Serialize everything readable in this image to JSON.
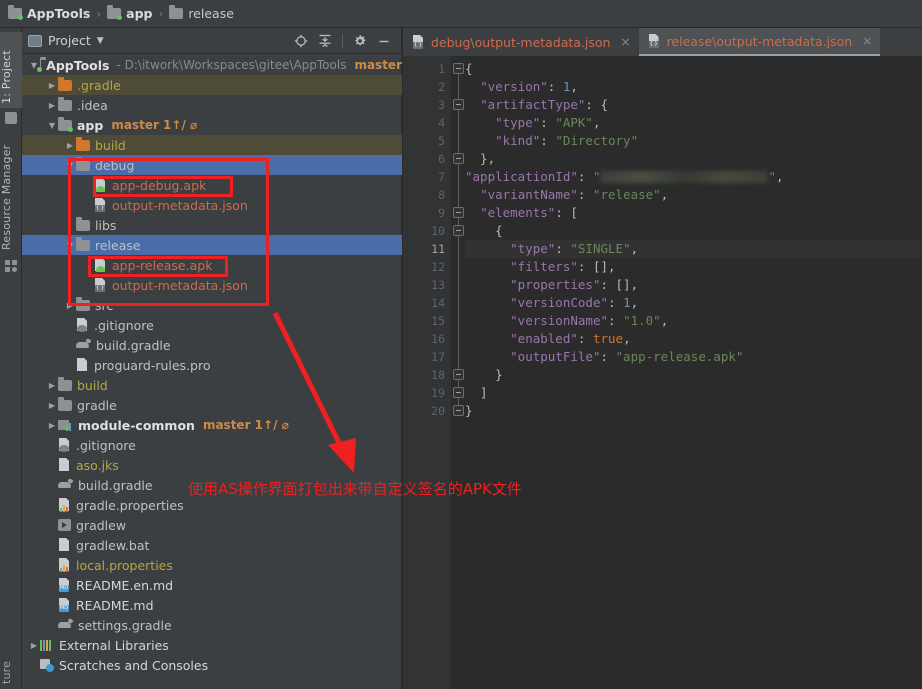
{
  "breadcrumb": {
    "items": [
      {
        "label": "AppTools",
        "icon": "module-icon",
        "bold": true
      },
      {
        "label": "app",
        "icon": "module-icon",
        "bold": true
      },
      {
        "label": "release",
        "icon": "folder-icon",
        "bold": false
      }
    ],
    "separator": "›"
  },
  "toolstrip": {
    "project_tab": "1: Project",
    "resource_tab": "Resource Manager",
    "structure_tab": "ture"
  },
  "panel": {
    "title": "Project",
    "caret": "▼",
    "tools": [
      "locate-icon",
      "collapse-all-icon",
      "gear-icon",
      "minimize-icon"
    ]
  },
  "tree": [
    {
      "id": "apptools-root",
      "indent": 0,
      "arrow": "▼",
      "icon": "module",
      "label": "AppTools",
      "style": "bold",
      "path": "- D:\\itwork\\Workspaces\\gitee\\AppTools",
      "branch": "master"
    },
    {
      "id": "gradle-dir",
      "indent": 1,
      "arrow": "▶",
      "icon": "folder-orange",
      "label": ".gradle",
      "style": "yellow",
      "row": "hl"
    },
    {
      "id": "idea-dir",
      "indent": 1,
      "arrow": "▶",
      "icon": "folder",
      "label": ".idea",
      "style": "gray"
    },
    {
      "id": "app-module",
      "indent": 1,
      "arrow": "▼",
      "icon": "module",
      "label": "app",
      "style": "bold",
      "branch": "master 1↑/ ⌀"
    },
    {
      "id": "build-dir",
      "indent": 2,
      "arrow": "▶",
      "icon": "folder-orange",
      "label": "build",
      "style": "yellow",
      "row": "hl"
    },
    {
      "id": "debug-dir",
      "indent": 2,
      "arrow": "▼",
      "icon": "folder",
      "label": "debug",
      "style": "gray",
      "row": "sel"
    },
    {
      "id": "app-debug-apk",
      "indent": 3,
      "arrow": "",
      "icon": "apk",
      "label": "app-debug.apk",
      "style": "red"
    },
    {
      "id": "debug-metadata",
      "indent": 3,
      "arrow": "",
      "icon": "json",
      "label": "output-metadata.json",
      "style": "red"
    },
    {
      "id": "libs-dir",
      "indent": 2,
      "arrow": "",
      "icon": "folder",
      "label": "libs",
      "style": "gray"
    },
    {
      "id": "release-dir",
      "indent": 2,
      "arrow": "▼",
      "icon": "folder",
      "label": "release",
      "style": "gray",
      "row": "sel"
    },
    {
      "id": "app-release-apk",
      "indent": 3,
      "arrow": "",
      "icon": "apk",
      "label": "app-release.apk",
      "style": "red"
    },
    {
      "id": "release-metadata",
      "indent": 3,
      "arrow": "",
      "icon": "json",
      "label": "output-metadata.json",
      "style": "red"
    },
    {
      "id": "src-dir",
      "indent": 2,
      "arrow": "▶",
      "icon": "folder",
      "label": "src",
      "style": "gray"
    },
    {
      "id": "app-gitignore",
      "indent": 2,
      "arrow": "",
      "icon": "gitignore",
      "label": ".gitignore",
      "style": "gray"
    },
    {
      "id": "app-build-gradle",
      "indent": 2,
      "arrow": "",
      "icon": "gradle",
      "label": "build.gradle",
      "style": "gray"
    },
    {
      "id": "proguard-rules",
      "indent": 2,
      "arrow": "",
      "icon": "text",
      "label": "proguard-rules.pro",
      "style": "gray"
    },
    {
      "id": "root-build-dir",
      "indent": 1,
      "arrow": "▶",
      "icon": "folder",
      "label": "build",
      "style": "yellow"
    },
    {
      "id": "gradle-wrapper",
      "indent": 1,
      "arrow": "▶",
      "icon": "folder",
      "label": "gradle",
      "style": "gray"
    },
    {
      "id": "module-common",
      "indent": 1,
      "arrow": "▶",
      "icon": "module-lib",
      "label": "module-common",
      "style": "bold",
      "branch": "master 1↑/ ⌀"
    },
    {
      "id": "root-gitignore",
      "indent": 1,
      "arrow": "",
      "icon": "gitignore",
      "label": ".gitignore",
      "style": "gray"
    },
    {
      "id": "aso-jks",
      "indent": 1,
      "arrow": "",
      "icon": "text",
      "label": "aso.jks",
      "style": "yellow"
    },
    {
      "id": "root-build-gradle",
      "indent": 1,
      "arrow": "",
      "icon": "gradle",
      "label": "build.gradle",
      "style": "gray"
    },
    {
      "id": "gradle-properties",
      "indent": 1,
      "arrow": "",
      "icon": "props",
      "label": "gradle.properties",
      "style": "gray"
    },
    {
      "id": "gradlew",
      "indent": 1,
      "arrow": "",
      "icon": "exec",
      "label": "gradlew",
      "style": "gray"
    },
    {
      "id": "gradlew-bat",
      "indent": 1,
      "arrow": "",
      "icon": "text",
      "label": "gradlew.bat",
      "style": "gray"
    },
    {
      "id": "local-properties",
      "indent": 1,
      "arrow": "",
      "icon": "props",
      "label": "local.properties",
      "style": "yellow"
    },
    {
      "id": "readme-en-md",
      "indent": 1,
      "arrow": "",
      "icon": "md",
      "label": "README.en.md",
      "style": "white"
    },
    {
      "id": "readme-md",
      "indent": 1,
      "arrow": "",
      "icon": "md",
      "label": "README.md",
      "style": "white"
    },
    {
      "id": "settings-gradle",
      "indent": 1,
      "arrow": "",
      "icon": "gradle",
      "label": "settings.gradle",
      "style": "gray"
    },
    {
      "id": "external-libs",
      "indent": 0,
      "arrow": "▶",
      "icon": "extlib",
      "label": "External Libraries",
      "style": "white"
    },
    {
      "id": "scratches",
      "indent": 0,
      "arrow": "",
      "icon": "scratch",
      "label": "Scratches and Consoles",
      "style": "white"
    }
  ],
  "annotation": {
    "text": "使用AS操作界面打包出来带自定义签名的APK文件",
    "color": "#ee2020",
    "boxes": [
      "outer-group-box",
      "app-debug-apk-box",
      "app-release-apk-box"
    ],
    "arrow": "red-arrow"
  },
  "editor": {
    "tabs": [
      {
        "label": "debug\\output-metadata.json",
        "icon": "json-file-icon",
        "active": false,
        "close": "×"
      },
      {
        "label": "release\\output-metadata.json",
        "icon": "json-file-icon",
        "active": true,
        "close": "×"
      }
    ],
    "current_line": 11,
    "lines": [
      {
        "num": 1,
        "text": "{",
        "fold": "open"
      },
      {
        "num": 2,
        "text": "  \"version\": 1,"
      },
      {
        "num": 3,
        "text": "  \"artifactType\": {",
        "fold": "open"
      },
      {
        "num": 4,
        "text": "    \"type\": \"APK\","
      },
      {
        "num": 5,
        "text": "    \"kind\": \"Directory\""
      },
      {
        "num": 6,
        "text": "  },",
        "fold": "close"
      },
      {
        "num": 7,
        "text": "  \"applicationId\": \"█████████████\",",
        "redacted": true
      },
      {
        "num": 8,
        "text": "  \"variantName\": \"release\","
      },
      {
        "num": 9,
        "text": "  \"elements\": [",
        "fold": "open"
      },
      {
        "num": 10,
        "text": "    {",
        "fold": "open"
      },
      {
        "num": 11,
        "text": "      \"type\": \"SINGLE\",",
        "bulb": true
      },
      {
        "num": 12,
        "text": "      \"filters\": [],"
      },
      {
        "num": 13,
        "text": "      \"properties\": [],"
      },
      {
        "num": 14,
        "text": "      \"versionCode\": 1,"
      },
      {
        "num": 15,
        "text": "      \"versionName\": \"1.0\","
      },
      {
        "num": 16,
        "text": "      \"enabled\": true,"
      },
      {
        "num": 17,
        "text": "      \"outputFile\": \"app-release.apk\""
      },
      {
        "num": 18,
        "text": "    }",
        "fold": "close"
      },
      {
        "num": 19,
        "text": "  ]",
        "fold": "close"
      },
      {
        "num": 20,
        "text": "}",
        "fold": "close"
      }
    ]
  },
  "colors": {
    "selection_blue": "#4a6da7",
    "highlight_olive": "#4e4b36",
    "annotation_red": "#ee2020",
    "editor_bg": "#2b2b2b",
    "panel_bg": "#3c3f41",
    "string_green": "#6a8759",
    "key_purple": "#9876aa",
    "number_blue": "#6897bb",
    "keyword_orange": "#cc7832"
  }
}
